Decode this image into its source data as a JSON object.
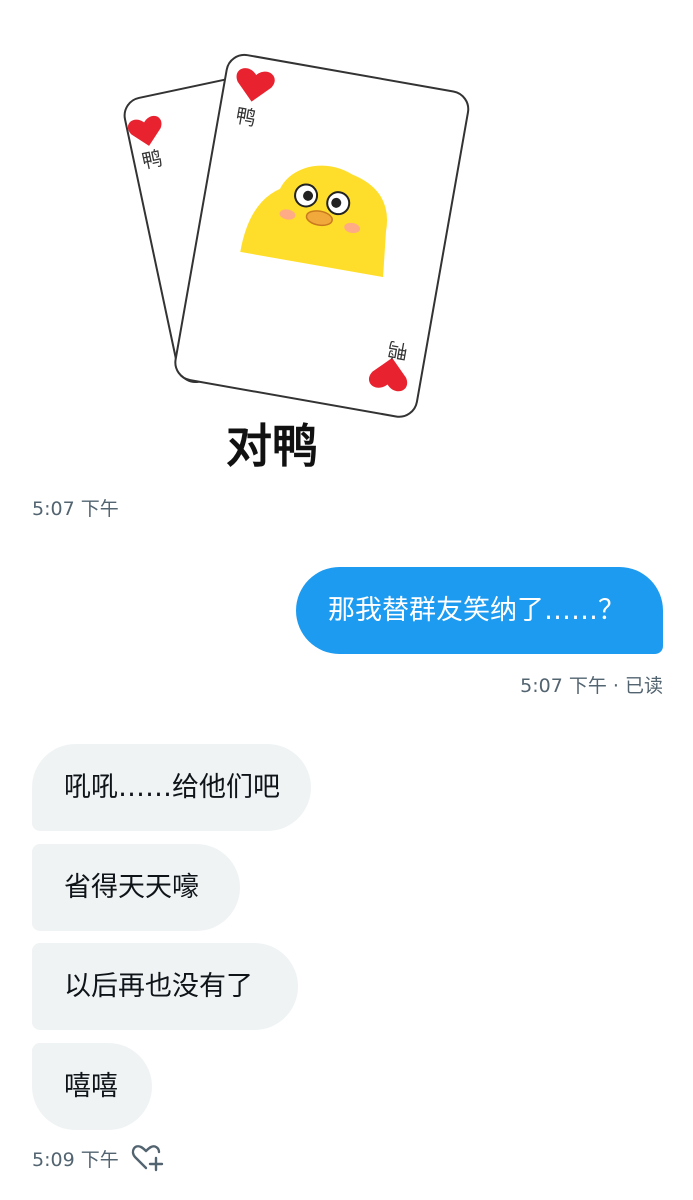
{
  "conversation": {
    "sticker": {
      "caption": "对鸭",
      "card_text": "鸭",
      "heart_color": "#e8232f",
      "duck_color": "#ffde2b"
    },
    "messages": [
      {
        "direction": "received",
        "kind": "sticker"
      },
      {
        "direction": "sent",
        "text": "那我替群友笑纳了……？"
      },
      {
        "direction": "received",
        "text": "吼吼……给他们吧"
      },
      {
        "direction": "received",
        "text": "省得天天嚎"
      },
      {
        "direction": "received",
        "text": "以后再也没有了"
      },
      {
        "direction": "received",
        "text": "嘻嘻"
      }
    ],
    "timestamps": {
      "sticker_time": "5:07 下午",
      "sent_status": "5:07 下午 · 已读",
      "last_time": "5:09 下午"
    },
    "icons": {
      "react": "heart-plus-icon"
    },
    "colors": {
      "sent_bubble": "#1d9bf0",
      "received_bubble": "#eff3f4",
      "timestamp": "#536471"
    }
  }
}
